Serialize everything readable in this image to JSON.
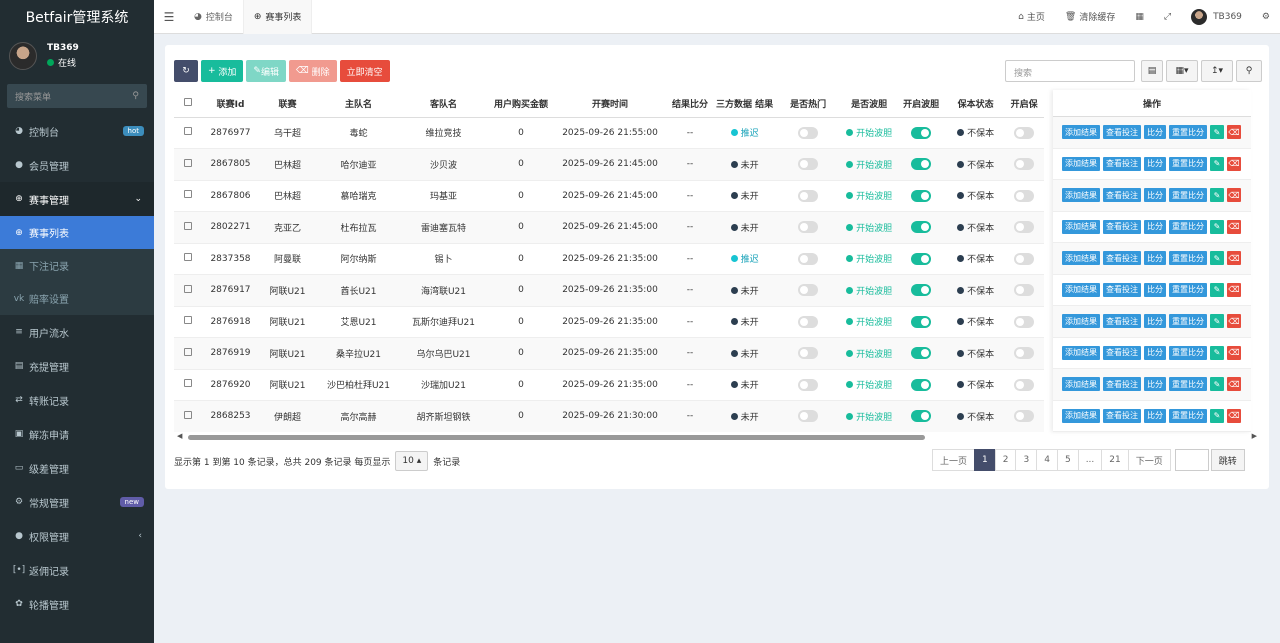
{
  "app_title": "Betfair管理系统",
  "user": {
    "name": "TB369",
    "status": "在线"
  },
  "sidebar": {
    "search_placeholder": "搜索菜单",
    "items": [
      {
        "label": "控制台",
        "icon": "dashboard-icon",
        "badge": "hot"
      },
      {
        "label": "会员管理",
        "icon": "users-icon"
      },
      {
        "label": "赛事管理",
        "icon": "plus-circle-icon"
      },
      {
        "label": "用户流水",
        "icon": "list-icon"
      },
      {
        "label": "充提管理",
        "icon": "table-icon"
      },
      {
        "label": "转账记录",
        "icon": "transfer-icon"
      },
      {
        "label": "解冻申请",
        "icon": "picture-icon"
      },
      {
        "label": "级差管理",
        "icon": "window-icon"
      },
      {
        "label": "常规管理",
        "icon": "cogs-icon",
        "badge": "new"
      },
      {
        "label": "权限管理",
        "icon": "group-icon"
      },
      {
        "label": "返佣记录",
        "icon": "code-icon"
      },
      {
        "label": "轮播管理",
        "icon": "award-icon"
      }
    ],
    "submenu": [
      {
        "label": "赛事列表",
        "icon": "plus-circle-icon"
      },
      {
        "label": "下注记录",
        "icon": "calendar-icon"
      },
      {
        "label": "赔率设置",
        "icon": "vk-icon"
      }
    ]
  },
  "header": {
    "tabs": [
      {
        "label": "控制台"
      },
      {
        "label": "赛事列表"
      }
    ],
    "home": "主页",
    "clear_cache": "清除缓存",
    "username": "TB369"
  },
  "toolbar": {
    "add": "添加",
    "edit": "编辑",
    "delete": "删除",
    "clear_now": "立即清空",
    "search_placeholder": "搜索"
  },
  "table": {
    "columns": [
      "联赛Id",
      "联赛",
      "主队名",
      "客队名",
      "用户购买金额",
      "开赛时间",
      "结果比分",
      "三方数据 结果",
      "是否热门",
      "是否波胆",
      "开启波胆",
      "保本状态",
      "开启保"
    ],
    "ops_header": "操作",
    "op_buttons": [
      "添加结果",
      "查看投注",
      "比分",
      "重置比分"
    ],
    "rows": [
      {
        "id": "2876977",
        "league": "乌干超",
        "home": "毒蛇",
        "away": "维拉竞技",
        "amount": "0",
        "time": "2025-09-26 21:55:00",
        "score": "--",
        "third": "推迟",
        "third_state": "cyan",
        "hot": false,
        "bodan": "开始波胆",
        "open_bodan": true,
        "baoben": "不保本",
        "open_baoben": false
      },
      {
        "id": "2867805",
        "league": "巴林超",
        "home": "哈尔迪亚",
        "away": "沙贝波",
        "amount": "0",
        "time": "2025-09-26 21:45:00",
        "score": "--",
        "third": "未开",
        "third_state": "dark",
        "hot": false,
        "bodan": "开始波胆",
        "open_bodan": true,
        "baoben": "不保本",
        "open_baoben": false
      },
      {
        "id": "2867806",
        "league": "巴林超",
        "home": "慕哈瑞克",
        "away": "玛基亚",
        "amount": "0",
        "time": "2025-09-26 21:45:00",
        "score": "--",
        "third": "未开",
        "third_state": "dark",
        "hot": false,
        "bodan": "开始波胆",
        "open_bodan": true,
        "baoben": "不保本",
        "open_baoben": false
      },
      {
        "id": "2802271",
        "league": "克亚乙",
        "home": "杜布拉瓦",
        "away": "雷迪塞瓦特",
        "amount": "0",
        "time": "2025-09-26 21:45:00",
        "score": "--",
        "third": "未开",
        "third_state": "dark",
        "hot": false,
        "bodan": "开始波胆",
        "open_bodan": true,
        "baoben": "不保本",
        "open_baoben": false
      },
      {
        "id": "2837358",
        "league": "阿曼联",
        "home": "阿尔纳斯",
        "away": "锡卜",
        "amount": "0",
        "time": "2025-09-26 21:35:00",
        "score": "--",
        "third": "推迟",
        "third_state": "cyan",
        "hot": false,
        "bodan": "开始波胆",
        "open_bodan": true,
        "baoben": "不保本",
        "open_baoben": false
      },
      {
        "id": "2876917",
        "league": "阿联U21",
        "home": "酋长U21",
        "away": "海湾联U21",
        "amount": "0",
        "time": "2025-09-26 21:35:00",
        "score": "--",
        "third": "未开",
        "third_state": "dark",
        "hot": false,
        "bodan": "开始波胆",
        "open_bodan": true,
        "baoben": "不保本",
        "open_baoben": false
      },
      {
        "id": "2876918",
        "league": "阿联U21",
        "home": "艾恩U21",
        "away": "瓦斯尔迪拜U21",
        "amount": "0",
        "time": "2025-09-26 21:35:00",
        "score": "--",
        "third": "未开",
        "third_state": "dark",
        "hot": false,
        "bodan": "开始波胆",
        "open_bodan": true,
        "baoben": "不保本",
        "open_baoben": false
      },
      {
        "id": "2876919",
        "league": "阿联U21",
        "home": "桑辛拉U21",
        "away": "乌尔乌巴U21",
        "amount": "0",
        "time": "2025-09-26 21:35:00",
        "score": "--",
        "third": "未开",
        "third_state": "dark",
        "hot": false,
        "bodan": "开始波胆",
        "open_bodan": true,
        "baoben": "不保本",
        "open_baoben": false
      },
      {
        "id": "2876920",
        "league": "阿联U21",
        "home": "沙巴柏杜拜U21",
        "away": "沙瑞加U21",
        "amount": "0",
        "time": "2025-09-26 21:35:00",
        "score": "--",
        "third": "未开",
        "third_state": "dark",
        "hot": false,
        "bodan": "开始波胆",
        "open_bodan": true,
        "baoben": "不保本",
        "open_baoben": false
      },
      {
        "id": "2868253",
        "league": "伊朗超",
        "home": "高尔高赫",
        "away": "胡齐斯坦钢铁",
        "amount": "0",
        "time": "2025-09-26 21:30:00",
        "score": "--",
        "third": "未开",
        "third_state": "dark",
        "hot": false,
        "bodan": "开始波胆",
        "open_bodan": true,
        "baoben": "不保本",
        "open_baoben": false
      }
    ]
  },
  "footer": {
    "info_prefix": "显示第 1 到第 10 条记录，总共 209 条记录 每页显示",
    "page_size": "10",
    "info_suffix": "条记录",
    "prev": "上一页",
    "next": "下一页",
    "pages": [
      "1",
      "2",
      "3",
      "4",
      "5",
      "...",
      "21"
    ],
    "go": "跳转"
  },
  "colors": {
    "sidebar_bg": "#222d32",
    "active_item": "#3c7bd8",
    "green": "#18bc9c",
    "red": "#e74c3c",
    "blue": "#3498db"
  }
}
